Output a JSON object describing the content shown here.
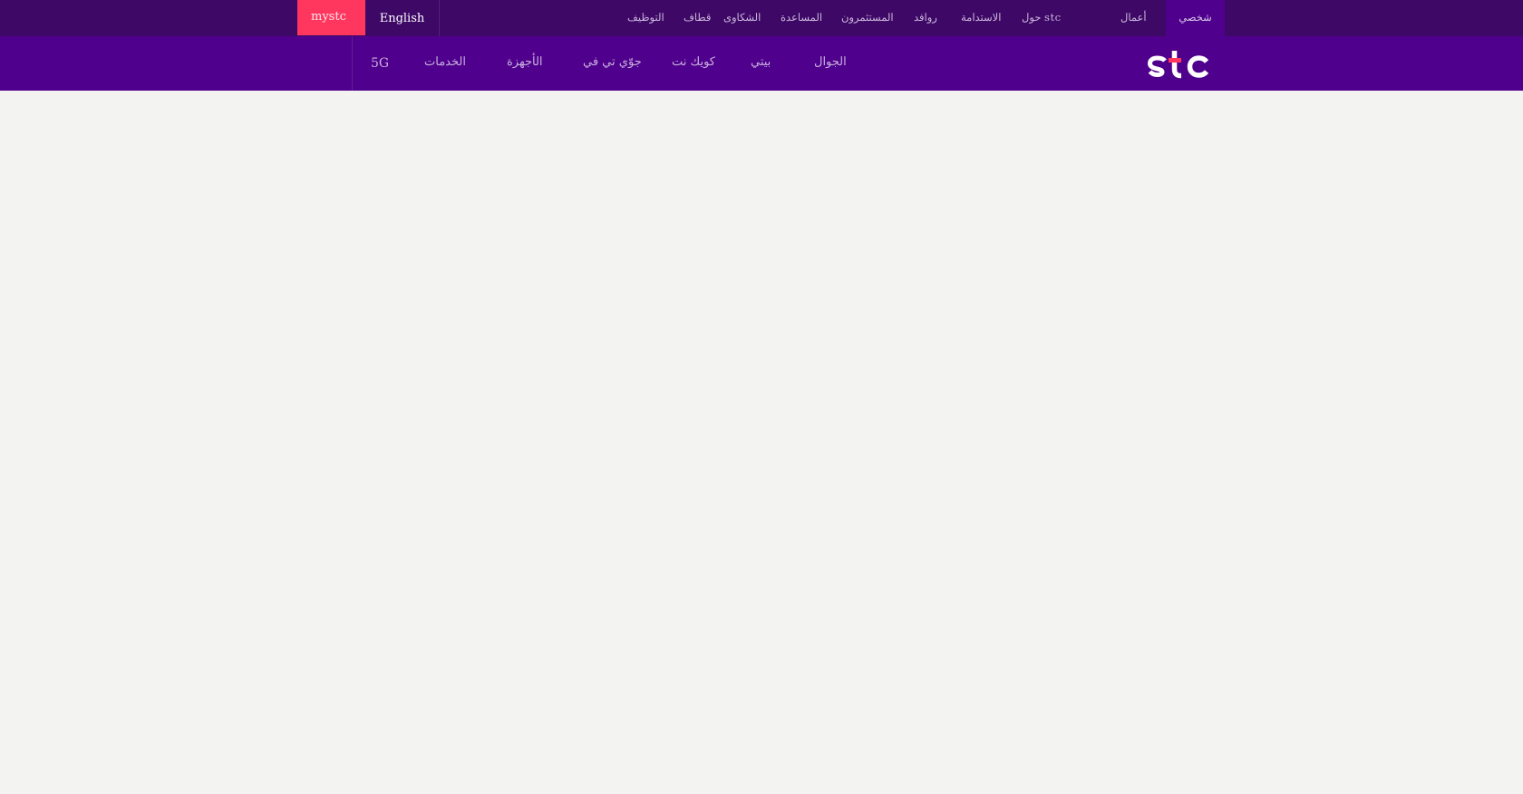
{
  "topbar": {
    "personal_tab": "شخصي",
    "business_tab": "أعمال",
    "links": [
      "حول stc",
      "الاستدامة",
      "روافد",
      "المستثمرون",
      "المساعدة",
      "الشكاوى",
      "قطاف",
      "التوظيف"
    ],
    "language_label": "English",
    "mystc_label": "mystc"
  },
  "mainnav": {
    "logo_text": "stc",
    "items": [
      "الجوال",
      "بيتي",
      "كويك نت",
      "جوّي تي في",
      "الأجهزة",
      "الخدمات",
      "5G"
    ]
  },
  "colors": {
    "topbar_bg": "#3e0866",
    "mainbar_bg": "#4f008c",
    "accent_mystc": "#ff375e",
    "page_bg": "#f3f3f1"
  }
}
